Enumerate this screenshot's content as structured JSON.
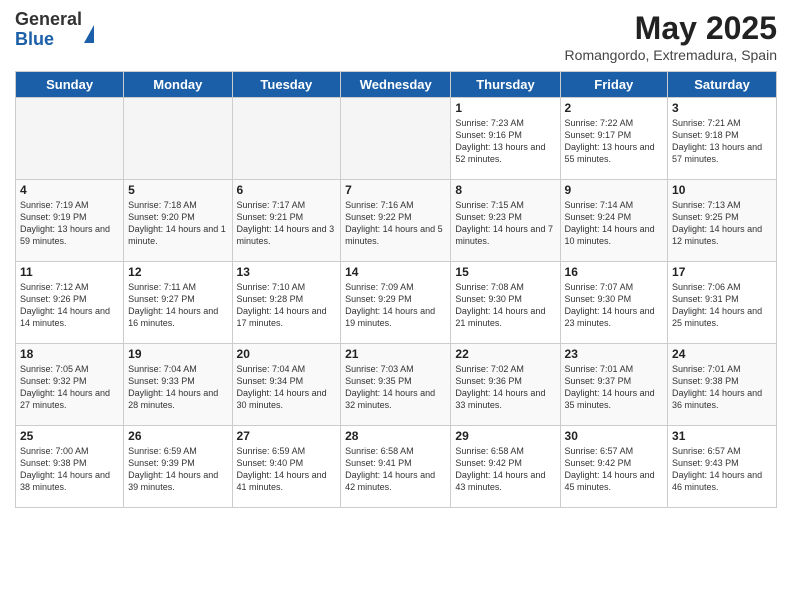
{
  "logo": {
    "general": "General",
    "blue": "Blue"
  },
  "title": "May 2025",
  "location": "Romangordo, Extremadura, Spain",
  "days_of_week": [
    "Sunday",
    "Monday",
    "Tuesday",
    "Wednesday",
    "Thursday",
    "Friday",
    "Saturday"
  ],
  "weeks": [
    [
      {
        "num": "",
        "info": ""
      },
      {
        "num": "",
        "info": ""
      },
      {
        "num": "",
        "info": ""
      },
      {
        "num": "",
        "info": ""
      },
      {
        "num": "1",
        "info": "Sunrise: 7:23 AM\nSunset: 9:16 PM\nDaylight: 13 hours\nand 52 minutes."
      },
      {
        "num": "2",
        "info": "Sunrise: 7:22 AM\nSunset: 9:17 PM\nDaylight: 13 hours\nand 55 minutes."
      },
      {
        "num": "3",
        "info": "Sunrise: 7:21 AM\nSunset: 9:18 PM\nDaylight: 13 hours\nand 57 minutes."
      }
    ],
    [
      {
        "num": "4",
        "info": "Sunrise: 7:19 AM\nSunset: 9:19 PM\nDaylight: 13 hours\nand 59 minutes."
      },
      {
        "num": "5",
        "info": "Sunrise: 7:18 AM\nSunset: 9:20 PM\nDaylight: 14 hours\nand 1 minute."
      },
      {
        "num": "6",
        "info": "Sunrise: 7:17 AM\nSunset: 9:21 PM\nDaylight: 14 hours\nand 3 minutes."
      },
      {
        "num": "7",
        "info": "Sunrise: 7:16 AM\nSunset: 9:22 PM\nDaylight: 14 hours\nand 5 minutes."
      },
      {
        "num": "8",
        "info": "Sunrise: 7:15 AM\nSunset: 9:23 PM\nDaylight: 14 hours\nand 7 minutes."
      },
      {
        "num": "9",
        "info": "Sunrise: 7:14 AM\nSunset: 9:24 PM\nDaylight: 14 hours\nand 10 minutes."
      },
      {
        "num": "10",
        "info": "Sunrise: 7:13 AM\nSunset: 9:25 PM\nDaylight: 14 hours\nand 12 minutes."
      }
    ],
    [
      {
        "num": "11",
        "info": "Sunrise: 7:12 AM\nSunset: 9:26 PM\nDaylight: 14 hours\nand 14 minutes."
      },
      {
        "num": "12",
        "info": "Sunrise: 7:11 AM\nSunset: 9:27 PM\nDaylight: 14 hours\nand 16 minutes."
      },
      {
        "num": "13",
        "info": "Sunrise: 7:10 AM\nSunset: 9:28 PM\nDaylight: 14 hours\nand 17 minutes."
      },
      {
        "num": "14",
        "info": "Sunrise: 7:09 AM\nSunset: 9:29 PM\nDaylight: 14 hours\nand 19 minutes."
      },
      {
        "num": "15",
        "info": "Sunrise: 7:08 AM\nSunset: 9:30 PM\nDaylight: 14 hours\nand 21 minutes."
      },
      {
        "num": "16",
        "info": "Sunrise: 7:07 AM\nSunset: 9:30 PM\nDaylight: 14 hours\nand 23 minutes."
      },
      {
        "num": "17",
        "info": "Sunrise: 7:06 AM\nSunset: 9:31 PM\nDaylight: 14 hours\nand 25 minutes."
      }
    ],
    [
      {
        "num": "18",
        "info": "Sunrise: 7:05 AM\nSunset: 9:32 PM\nDaylight: 14 hours\nand 27 minutes."
      },
      {
        "num": "19",
        "info": "Sunrise: 7:04 AM\nSunset: 9:33 PM\nDaylight: 14 hours\nand 28 minutes."
      },
      {
        "num": "20",
        "info": "Sunrise: 7:04 AM\nSunset: 9:34 PM\nDaylight: 14 hours\nand 30 minutes."
      },
      {
        "num": "21",
        "info": "Sunrise: 7:03 AM\nSunset: 9:35 PM\nDaylight: 14 hours\nand 32 minutes."
      },
      {
        "num": "22",
        "info": "Sunrise: 7:02 AM\nSunset: 9:36 PM\nDaylight: 14 hours\nand 33 minutes."
      },
      {
        "num": "23",
        "info": "Sunrise: 7:01 AM\nSunset: 9:37 PM\nDaylight: 14 hours\nand 35 minutes."
      },
      {
        "num": "24",
        "info": "Sunrise: 7:01 AM\nSunset: 9:38 PM\nDaylight: 14 hours\nand 36 minutes."
      }
    ],
    [
      {
        "num": "25",
        "info": "Sunrise: 7:00 AM\nSunset: 9:38 PM\nDaylight: 14 hours\nand 38 minutes."
      },
      {
        "num": "26",
        "info": "Sunrise: 6:59 AM\nSunset: 9:39 PM\nDaylight: 14 hours\nand 39 minutes."
      },
      {
        "num": "27",
        "info": "Sunrise: 6:59 AM\nSunset: 9:40 PM\nDaylight: 14 hours\nand 41 minutes."
      },
      {
        "num": "28",
        "info": "Sunrise: 6:58 AM\nSunset: 9:41 PM\nDaylight: 14 hours\nand 42 minutes."
      },
      {
        "num": "29",
        "info": "Sunrise: 6:58 AM\nSunset: 9:42 PM\nDaylight: 14 hours\nand 43 minutes."
      },
      {
        "num": "30",
        "info": "Sunrise: 6:57 AM\nSunset: 9:42 PM\nDaylight: 14 hours\nand 45 minutes."
      },
      {
        "num": "31",
        "info": "Sunrise: 6:57 AM\nSunset: 9:43 PM\nDaylight: 14 hours\nand 46 minutes."
      }
    ]
  ]
}
